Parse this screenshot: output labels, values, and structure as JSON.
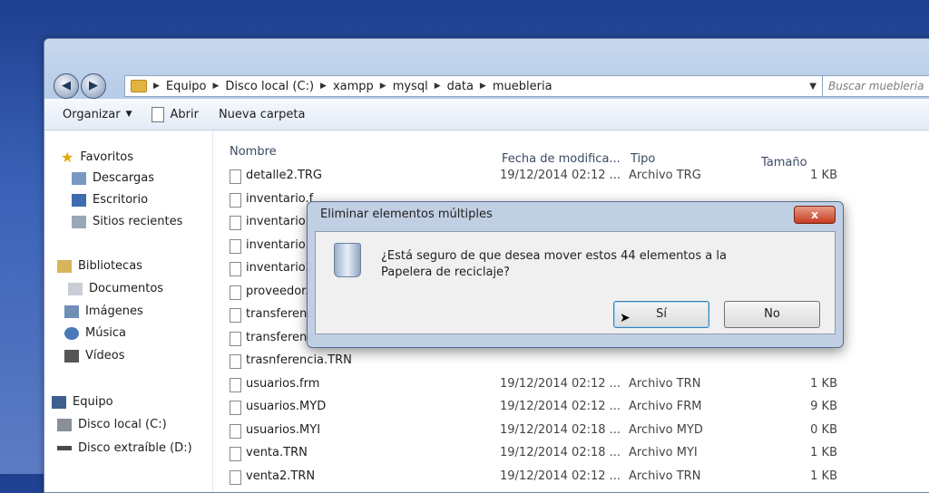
{
  "breadcrumb": [
    "Equipo",
    "Disco local (C:)",
    "xampp",
    "mysql",
    "data",
    "muebleria"
  ],
  "search_placeholder": "Buscar muebleria",
  "toolbar": {
    "organize": "Organizar",
    "open": "Abrir",
    "new_folder": "Nueva carpeta"
  },
  "nav": {
    "favorites": "Favoritos",
    "downloads": "Descargas",
    "desktop": "Escritorio",
    "recent": "Sitios recientes",
    "libraries": "Bibliotecas",
    "documents": "Documentos",
    "images": "Imágenes",
    "music": "Música",
    "videos": "Vídeos",
    "computer": "Equipo",
    "local_disk": "Disco local (C:)",
    "removable": "Disco extraíble (D:)"
  },
  "columns": {
    "name": "Nombre",
    "date": "Fecha de modifica...",
    "type": "Tipo",
    "size": "Tamaño"
  },
  "files": [
    {
      "name": "detalle2.TRG",
      "date": "19/12/2014 02:12 ...",
      "type": "Archivo TRG",
      "size": "1 KB"
    },
    {
      "name": "inventario.f",
      "date": "",
      "type": "",
      "size": ""
    },
    {
      "name": "inventario.",
      "date": "",
      "type": "",
      "size": ""
    },
    {
      "name": "inventario.",
      "date": "",
      "type": "",
      "size": ""
    },
    {
      "name": "inventario2",
      "date": "",
      "type": "",
      "size": ""
    },
    {
      "name": "proveedor.",
      "date": "",
      "type": "",
      "size": ""
    },
    {
      "name": "transferenc",
      "date": "",
      "type": "",
      "size": ""
    },
    {
      "name": "transferenc",
      "date": "",
      "type": "",
      "size": ""
    },
    {
      "name": "trasnferencia.TRN",
      "date": "",
      "type": "",
      "size": ""
    },
    {
      "name": "usuarios.frm",
      "date": "19/12/2014 02:12 ...",
      "type": "Archivo TRN",
      "size": "1 KB"
    },
    {
      "name": "usuarios.MYD",
      "date": "19/12/2014 02:12 ...",
      "type": "Archivo FRM",
      "size": "9 KB"
    },
    {
      "name": "usuarios.MYI",
      "date": "19/12/2014 02:18 ...",
      "type": "Archivo MYD",
      "size": "0 KB"
    },
    {
      "name": "venta.TRN",
      "date": "19/12/2014 02:18 ...",
      "type": "Archivo MYI",
      "size": "1 KB"
    },
    {
      "name": "venta2.TRN",
      "date": "19/12/2014 02:12 ...",
      "type": "Archivo TRN",
      "size": "1 KB"
    }
  ],
  "dialog": {
    "title": "Eliminar elementos múltiples",
    "close": "x",
    "message": "¿Está seguro de que desea mover estos 44 elementos a la Papelera de reciclaje?",
    "yes": "Sí",
    "no": "No"
  }
}
